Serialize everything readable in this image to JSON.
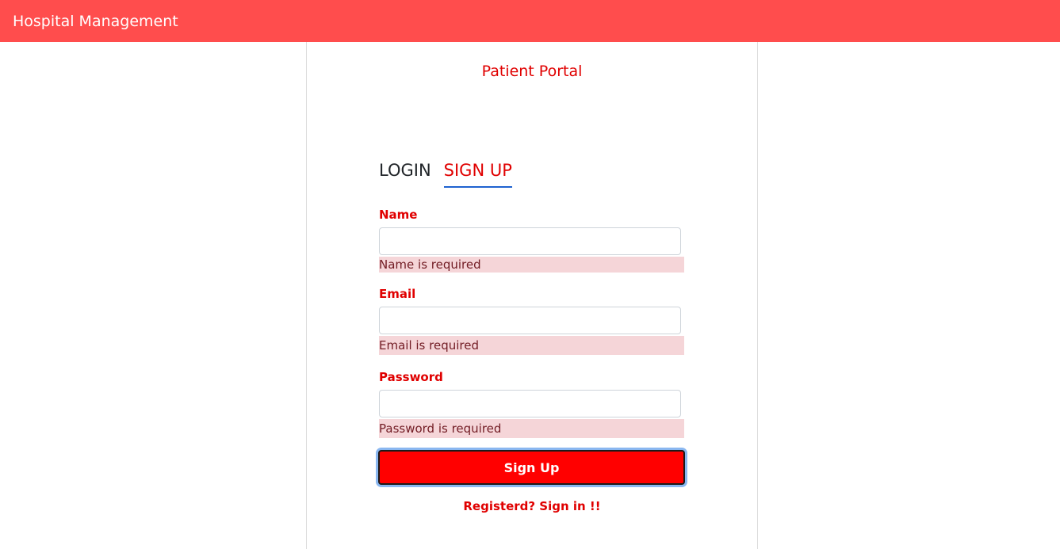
{
  "navbar": {
    "brand": "Hospital Management"
  },
  "portal": {
    "title": "Patient Portal"
  },
  "tabs": [
    {
      "label": "LOGIN",
      "active": false
    },
    {
      "label": "SIGN UP",
      "active": true
    }
  ],
  "form": {
    "name": {
      "label": "Name",
      "value": "",
      "error": "Name is required"
    },
    "email": {
      "label": "Email",
      "value": "",
      "error": "Email is required"
    },
    "password": {
      "label": "Password",
      "value": "",
      "error": "Password is required"
    },
    "submit_label": "Sign Up",
    "signin_link": "Registerd? Sign in !!"
  },
  "colors": {
    "navbar": "#ff4d4d",
    "accent": "#e00000",
    "button": "#ff0000",
    "error_bg": "#f5d5d8",
    "error_text": "#721c24",
    "active_tab_underline": "#1e62d0"
  }
}
